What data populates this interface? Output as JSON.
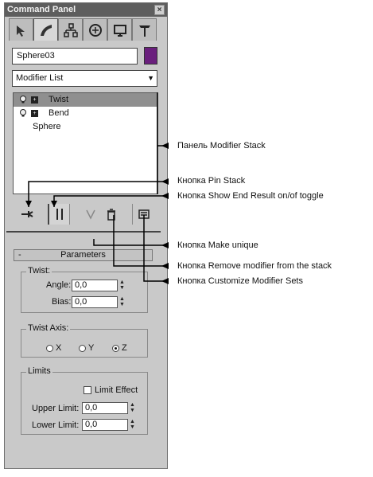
{
  "panel": {
    "title": "Command Panel",
    "close": "×"
  },
  "tabs": [
    "create-icon",
    "modify-icon",
    "hierarchy-icon",
    "motion-icon",
    "display-icon",
    "utilities-icon"
  ],
  "object": {
    "name": "Sphere03",
    "color": "#6a1f7d"
  },
  "modifier_list": {
    "value": "Modifier List"
  },
  "stack": {
    "items": [
      {
        "label": "Twist",
        "selected": true
      },
      {
        "label": "Bend",
        "selected": false
      },
      {
        "label": "Sphere",
        "selected": false
      }
    ]
  },
  "parameters": {
    "rollout_title": "Parameters",
    "minus": "-",
    "twist_group": "Twist:",
    "angle_label": "Angle:",
    "angle_value": "0,0",
    "bias_label": "Bias:",
    "bias_value": "0,0",
    "axis_group": "Twist Axis:",
    "axis_x": "X",
    "axis_y": "Y",
    "axis_z": "Z",
    "limits_group": "Limits",
    "limit_effect": "Limit Effect",
    "upper_label": "Upper Limit:",
    "upper_value": "0,0",
    "lower_label": "Lower Limit:",
    "lower_value": "0,0"
  },
  "callouts": {
    "stack_panel": "Панель Modifier Stack",
    "pin_stack": "Кнопка Pin Stack",
    "show_end": "Кнопка Show End Result on/of toggle",
    "make_unique": "Кнопка Make unique",
    "remove_mod": "Кнопка Remove modifier from the stack",
    "customize": "Кнопка Customize Modifier Sets"
  }
}
